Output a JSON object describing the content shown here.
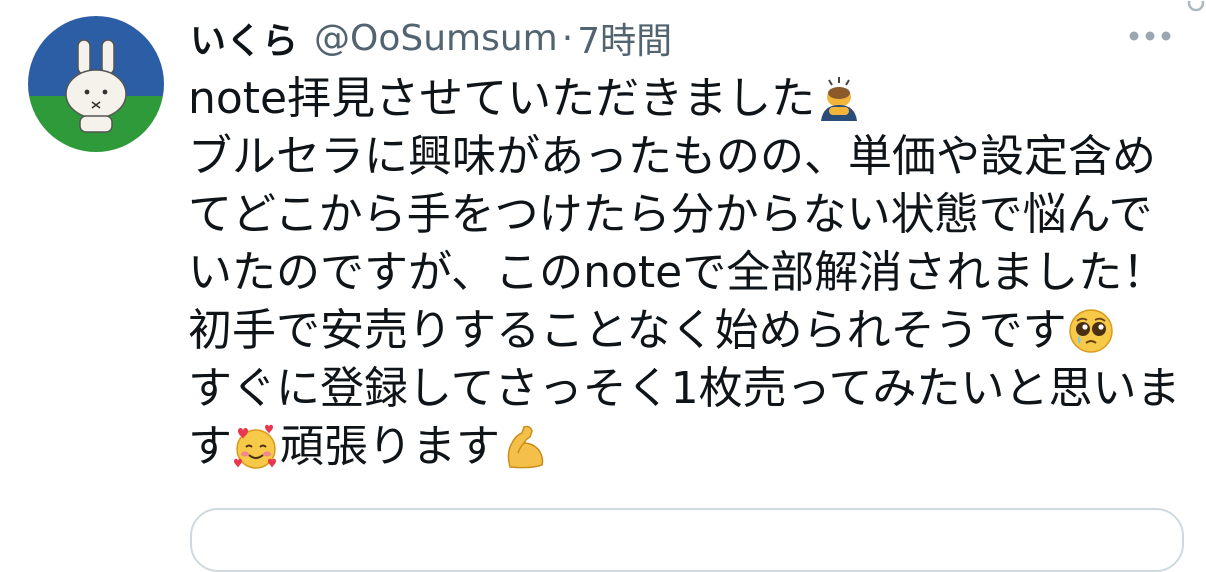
{
  "tweet": {
    "author": {
      "display_name": "いくら",
      "handle": "@OoSumsum",
      "avatar_icon": "miffy-bunny-avatar"
    },
    "separator": "·",
    "time": "7時間",
    "more_icon": "ellipsis-icon",
    "lines": [
      {
        "text": "note拝見させていただきました",
        "emoji_after": "person-bowing-emoji"
      },
      {
        "text": "ブルセラに興味があったものの、単価や設定含め"
      },
      {
        "text": "てどこから手をつけたら分からない状態で悩んで"
      },
      {
        "text": "いたのですが、このnoteで全部解消されました！"
      },
      {
        "text": "初手で安売りすることなく始められそうです",
        "emoji_after": "pleading-face-emoji"
      },
      {
        "text": "すぐに登録してさっそく1枚売ってみたいと思いま"
      },
      {
        "text_before": "す",
        "emoji_mid": "smiling-face-with-hearts-emoji",
        "text_after": "頑張ります",
        "emoji_after": "flexed-biceps-emoji"
      }
    ]
  },
  "colors": {
    "text_primary": "#0f1419",
    "text_secondary": "#536471",
    "border": "#cfd9de",
    "avatar_sky": "#2b5ea4",
    "avatar_grass": "#2e9a3a"
  }
}
